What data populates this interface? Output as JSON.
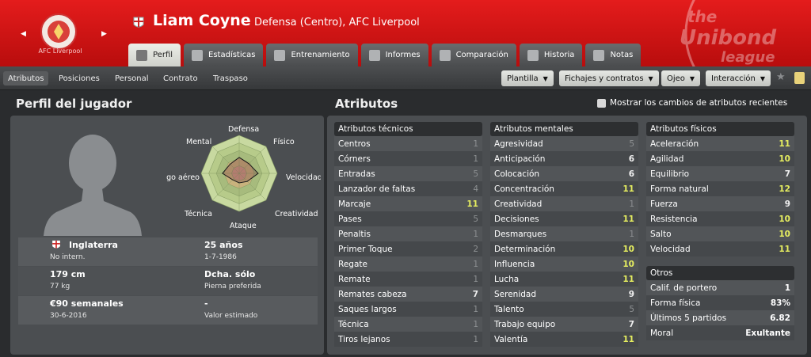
{
  "header": {
    "club_name": "AFC Liverpool",
    "player_name": "Liam Coyne",
    "subtitle": "Defensa (Centro), AFC Liverpool",
    "league_logo_text": "the Unibond league",
    "tabs": [
      {
        "label": "Perfil",
        "icon": "profile-icon"
      },
      {
        "label": "Estadísticas",
        "icon": "stats-icon"
      },
      {
        "label": "Entrenamiento",
        "icon": "training-icon"
      },
      {
        "label": "Informes",
        "icon": "report-icon"
      },
      {
        "label": "Comparación",
        "icon": "compare-icon"
      },
      {
        "label": "Historia",
        "icon": "history-icon"
      },
      {
        "label": "Notas",
        "icon": "notes-icon"
      }
    ],
    "active_tab": "Perfil"
  },
  "subnav": {
    "items": [
      "Atributos",
      "Posiciones",
      "Personal",
      "Contrato",
      "Traspaso"
    ],
    "active": "Atributos",
    "menus": [
      "Plantilla",
      "Fichajes y contratos",
      "Ojeo",
      "Interacción"
    ]
  },
  "profile": {
    "title": "Perfil del jugador",
    "radar_labels": {
      "top": "Defensa",
      "top_right": "Físico",
      "right": "Velocidad",
      "bottom_right": "Creatividad",
      "bottom": "Ataque",
      "bottom_left": "Técnica",
      "left": "Juego aéreo",
      "top_left": "Mental"
    },
    "radar_values": [
      0.42,
      0.36,
      0.5,
      0.3,
      0.25,
      0.24,
      0.44,
      0.34
    ],
    "info": [
      {
        "big": "Inglaterra",
        "small": "No intern.",
        "big2": "25 años",
        "small2": "1-7-1986"
      },
      {
        "big": "179 cm",
        "small": "77 kg",
        "big2": "Dcha. sólo",
        "small2": "Pierna preferida"
      },
      {
        "big": "€90 semanales",
        "small": "30-6-2016",
        "big2": "-",
        "small2": "Valor estimado"
      }
    ]
  },
  "attributes": {
    "title": "Atributos",
    "show_changes_label": "Mostrar los cambios de atributos recientes",
    "technical": {
      "header": "Atributos técnicos",
      "rows": [
        [
          "Centros",
          "1"
        ],
        [
          "Córners",
          "1"
        ],
        [
          "Entradas",
          "5"
        ],
        [
          "Lanzador de faltas",
          "4"
        ],
        [
          "Marcaje",
          "11"
        ],
        [
          "Pases",
          "5"
        ],
        [
          "Penaltis",
          "1"
        ],
        [
          "Primer Toque",
          "2"
        ],
        [
          "Regate",
          "1"
        ],
        [
          "Remate",
          "1"
        ],
        [
          "Remates cabeza",
          "7"
        ],
        [
          "Saques largos",
          "1"
        ],
        [
          "Técnica",
          "1"
        ],
        [
          "Tiros lejanos",
          "1"
        ]
      ]
    },
    "mental": {
      "header": "Atributos mentales",
      "rows": [
        [
          "Agresividad",
          "5"
        ],
        [
          "Anticipación",
          "6"
        ],
        [
          "Colocación",
          "6"
        ],
        [
          "Concentración",
          "11"
        ],
        [
          "Creatividad",
          "1"
        ],
        [
          "Decisiones",
          "11"
        ],
        [
          "Desmarques",
          "1"
        ],
        [
          "Determinación",
          "10"
        ],
        [
          "Influencia",
          "10"
        ],
        [
          "Lucha",
          "11"
        ],
        [
          "Serenidad",
          "9"
        ],
        [
          "Talento",
          "5"
        ],
        [
          "Trabajo equipo",
          "7"
        ],
        [
          "Valentía",
          "11"
        ]
      ]
    },
    "physical": {
      "header": "Atributos físicos",
      "rows": [
        [
          "Aceleración",
          "11"
        ],
        [
          "Agilidad",
          "10"
        ],
        [
          "Equilibrio",
          "7"
        ],
        [
          "Forma natural",
          "12"
        ],
        [
          "Fuerza",
          "9"
        ],
        [
          "Resistencia",
          "10"
        ],
        [
          "Salto",
          "10"
        ],
        [
          "Velocidad",
          "11"
        ]
      ]
    },
    "others": {
      "header": "Otros",
      "rows": [
        [
          "Calif. de portero",
          "1"
        ],
        [
          "Forma física",
          "83%"
        ],
        [
          "Últimos 5 partidos",
          "6.82"
        ],
        [
          "Moral",
          "Exultante"
        ]
      ]
    }
  },
  "colors": {
    "header_red": "#d41515",
    "high_value": "#e6ee60",
    "low_value": "#8d9092"
  }
}
